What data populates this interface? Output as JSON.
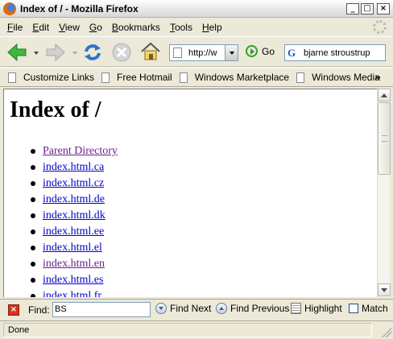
{
  "window": {
    "title": "Index of / - Mozilla Firefox",
    "controls": {
      "minimize": "_",
      "maximize": "□",
      "close": "×"
    }
  },
  "menu": [
    "File",
    "Edit",
    "View",
    "Go",
    "Bookmarks",
    "Tools",
    "Help"
  ],
  "menu_access_keys": [
    "F",
    "E",
    "V",
    "G",
    "B",
    "T",
    "H"
  ],
  "toolbar": {
    "url": "http://w",
    "go_label": "Go",
    "search_value": "bjarne stroustrup",
    "search_engine_icon": "google-icon"
  },
  "bookmarks": {
    "items": [
      "Customize Links",
      "Free Hotmail",
      "Windows Marketplace",
      "Windows Media"
    ],
    "overflow": "»"
  },
  "page": {
    "heading": "Index of /",
    "links": [
      {
        "text": "Parent Directory",
        "visited": true
      },
      {
        "text": "index.html.ca",
        "visited": false
      },
      {
        "text": "index.html.cz",
        "visited": false
      },
      {
        "text": "index.html.de",
        "visited": false
      },
      {
        "text": "index.html.dk",
        "visited": false
      },
      {
        "text": "index.html.ee",
        "visited": false
      },
      {
        "text": "index.html.el",
        "visited": false
      },
      {
        "text": "index.html.en",
        "visited": true
      },
      {
        "text": "index.html.es",
        "visited": false
      },
      {
        "text": "index.html.fr",
        "visited": false
      }
    ]
  },
  "findbar": {
    "label": "Find:",
    "value": "BS",
    "find_next": "Find Next",
    "find_previous": "Find Previous",
    "highlight": "Highlight",
    "match_case": "Match",
    "match_case_checked": false
  },
  "status": {
    "text": "Done"
  },
  "colors": {
    "chrome": "#ece9d8",
    "link": "#0000cc",
    "visited_link": "#6e1e8c",
    "back_arrow": "#2fa02f",
    "close_red": "#d9321f"
  }
}
